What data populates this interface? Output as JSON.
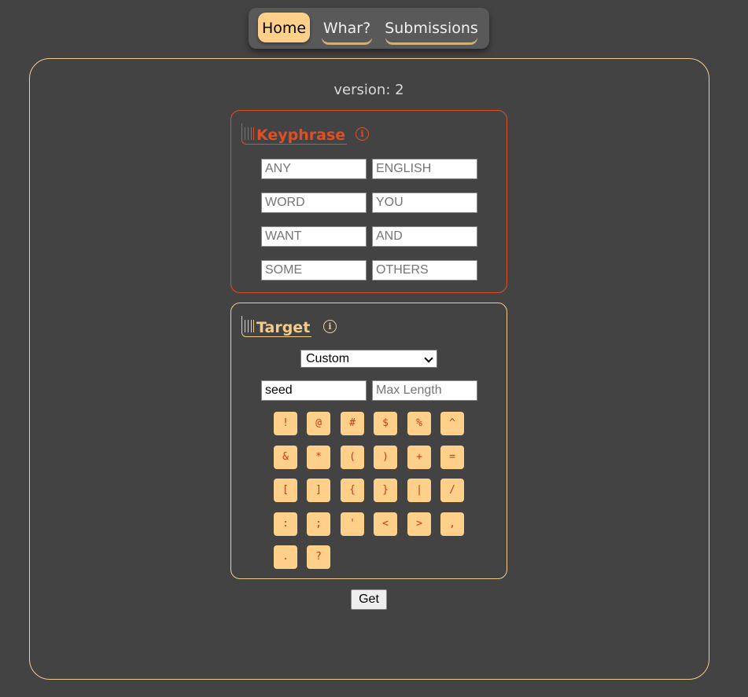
{
  "nav": {
    "items": [
      {
        "label": "Home",
        "active": true
      },
      {
        "label": "Whar?",
        "active": false
      },
      {
        "label": "Submissions",
        "active": false
      }
    ]
  },
  "version_text": "version: 2",
  "keyphrase": {
    "title": "Keyphrase",
    "info_icon": "info-icon",
    "fields": [
      {
        "value": "",
        "placeholder": "ANY"
      },
      {
        "value": "",
        "placeholder": "ENGLISH"
      },
      {
        "value": "",
        "placeholder": "WORD"
      },
      {
        "value": "",
        "placeholder": "YOU"
      },
      {
        "value": "",
        "placeholder": "WANT"
      },
      {
        "value": "",
        "placeholder": "AND"
      },
      {
        "value": "",
        "placeholder": "SOME"
      },
      {
        "value": "",
        "placeholder": "OTHERS"
      }
    ]
  },
  "target": {
    "title": "Target",
    "info_icon": "info-icon",
    "select_value": "Custom",
    "seed": {
      "value": "seed",
      "placeholder": ""
    },
    "max_length": {
      "value": "",
      "placeholder": "Max Length"
    },
    "characters": [
      "!",
      "@",
      "#",
      "$",
      "%",
      "^",
      "&",
      "*",
      "(",
      ")",
      "+",
      "=",
      "[",
      "]",
      "{",
      "}",
      "|",
      "/",
      ":",
      ";",
      "'",
      "<",
      ">",
      ",",
      ".",
      "?"
    ]
  },
  "get_label": "Get",
  "colors": {
    "background": "#434343",
    "accent": "#ffd08a",
    "keyphrase_border": "#e04e26",
    "target_border": "#f2cc8c"
  }
}
